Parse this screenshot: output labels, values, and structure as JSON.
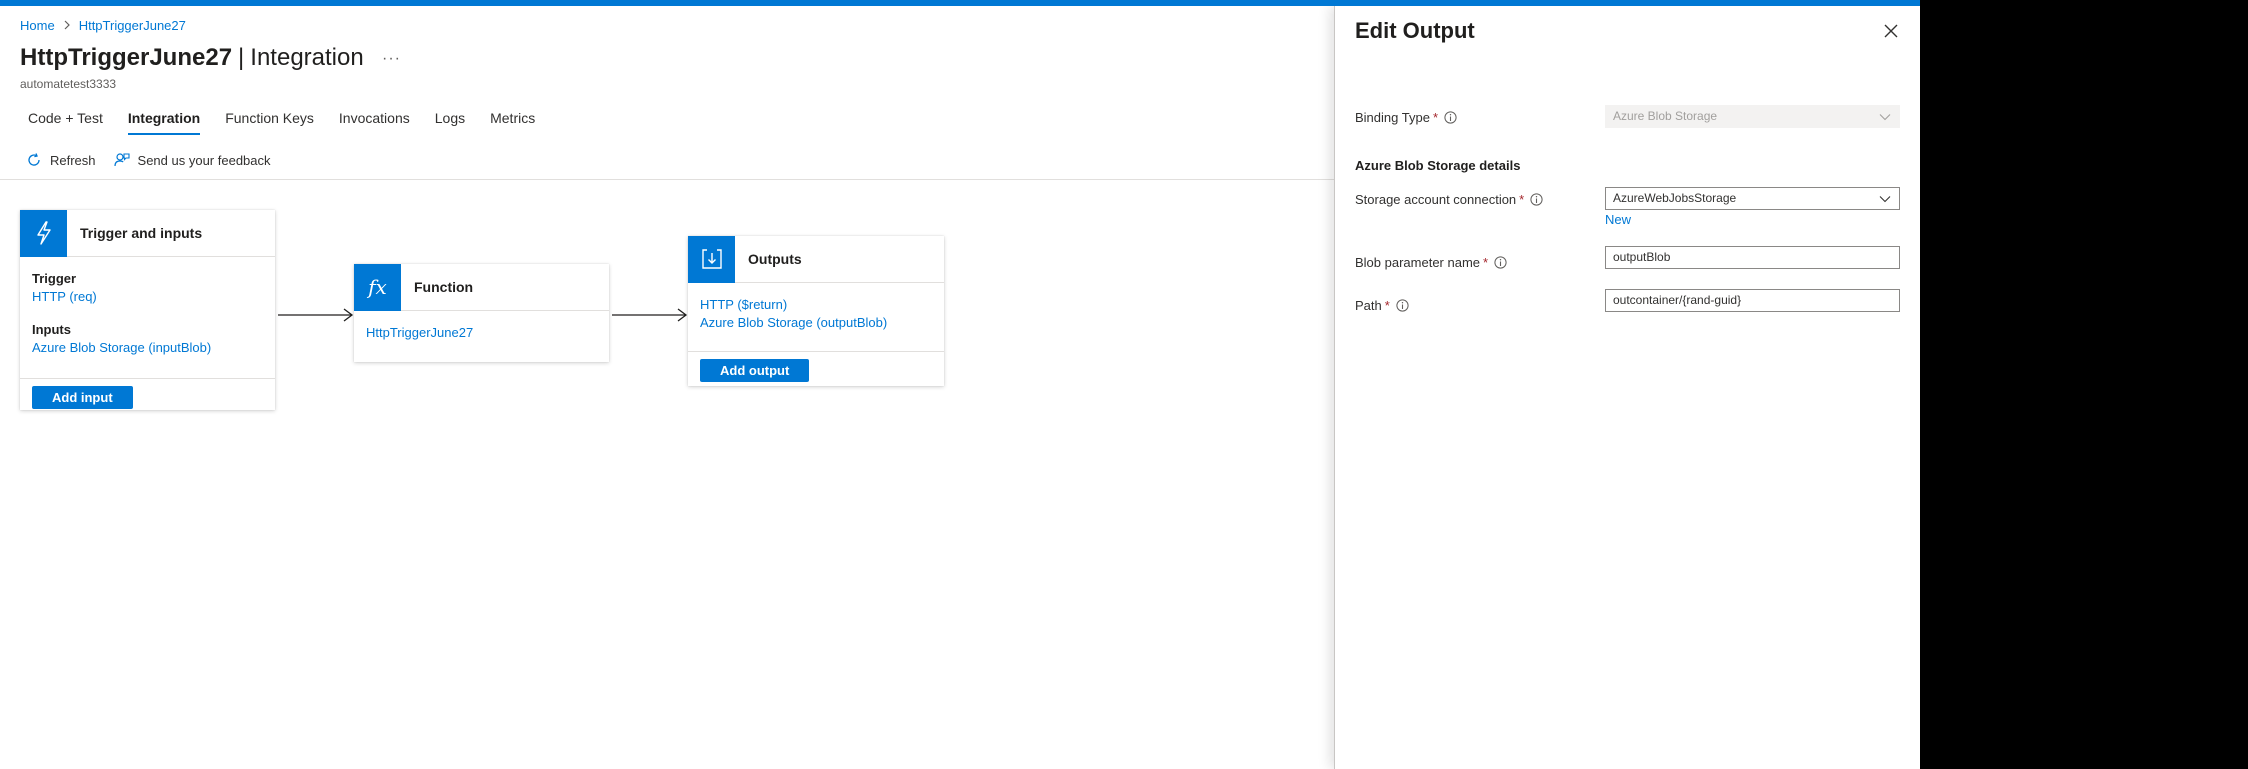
{
  "breadcrumb": {
    "home": "Home",
    "current": "HttpTriggerJune27"
  },
  "header": {
    "name": "HttpTriggerJune27",
    "separator": "|",
    "page": "Integration",
    "more": "···",
    "subtitle": "automatetest3333"
  },
  "tabs": [
    {
      "label": "Code + Test"
    },
    {
      "label": "Integration",
      "active": true
    },
    {
      "label": "Function Keys"
    },
    {
      "label": "Invocations"
    },
    {
      "label": "Logs"
    },
    {
      "label": "Metrics"
    }
  ],
  "toolbar": {
    "refresh": "Refresh",
    "feedback": "Send us your feedback"
  },
  "trigger_card": {
    "title": "Trigger and inputs",
    "trigger_label": "Trigger",
    "trigger_value": "HTTP (req)",
    "inputs_label": "Inputs",
    "inputs_value": "Azure Blob Storage (inputBlob)",
    "button": "Add input"
  },
  "function_card": {
    "title": "Function",
    "icon_text": "fx",
    "value": "HttpTriggerJune27"
  },
  "outputs_card": {
    "title": "Outputs",
    "items": [
      "HTTP ($return)",
      "Azure Blob Storage (outputBlob)"
    ],
    "button": "Add output"
  },
  "panel": {
    "title": "Edit Output",
    "binding_type_label": "Binding Type",
    "binding_type_value": "Azure Blob Storage",
    "section_title": "Azure Blob Storage details",
    "storage_label": "Storage account connection",
    "storage_value": "AzureWebJobsStorage",
    "new_link": "New",
    "param_label": "Blob parameter name",
    "param_value": "outputBlob",
    "path_label": "Path",
    "path_value": "outcontainer/{rand-guid}",
    "required_mark": "*"
  },
  "colors": {
    "accent": "#0078d4",
    "required": "#a4262c"
  }
}
